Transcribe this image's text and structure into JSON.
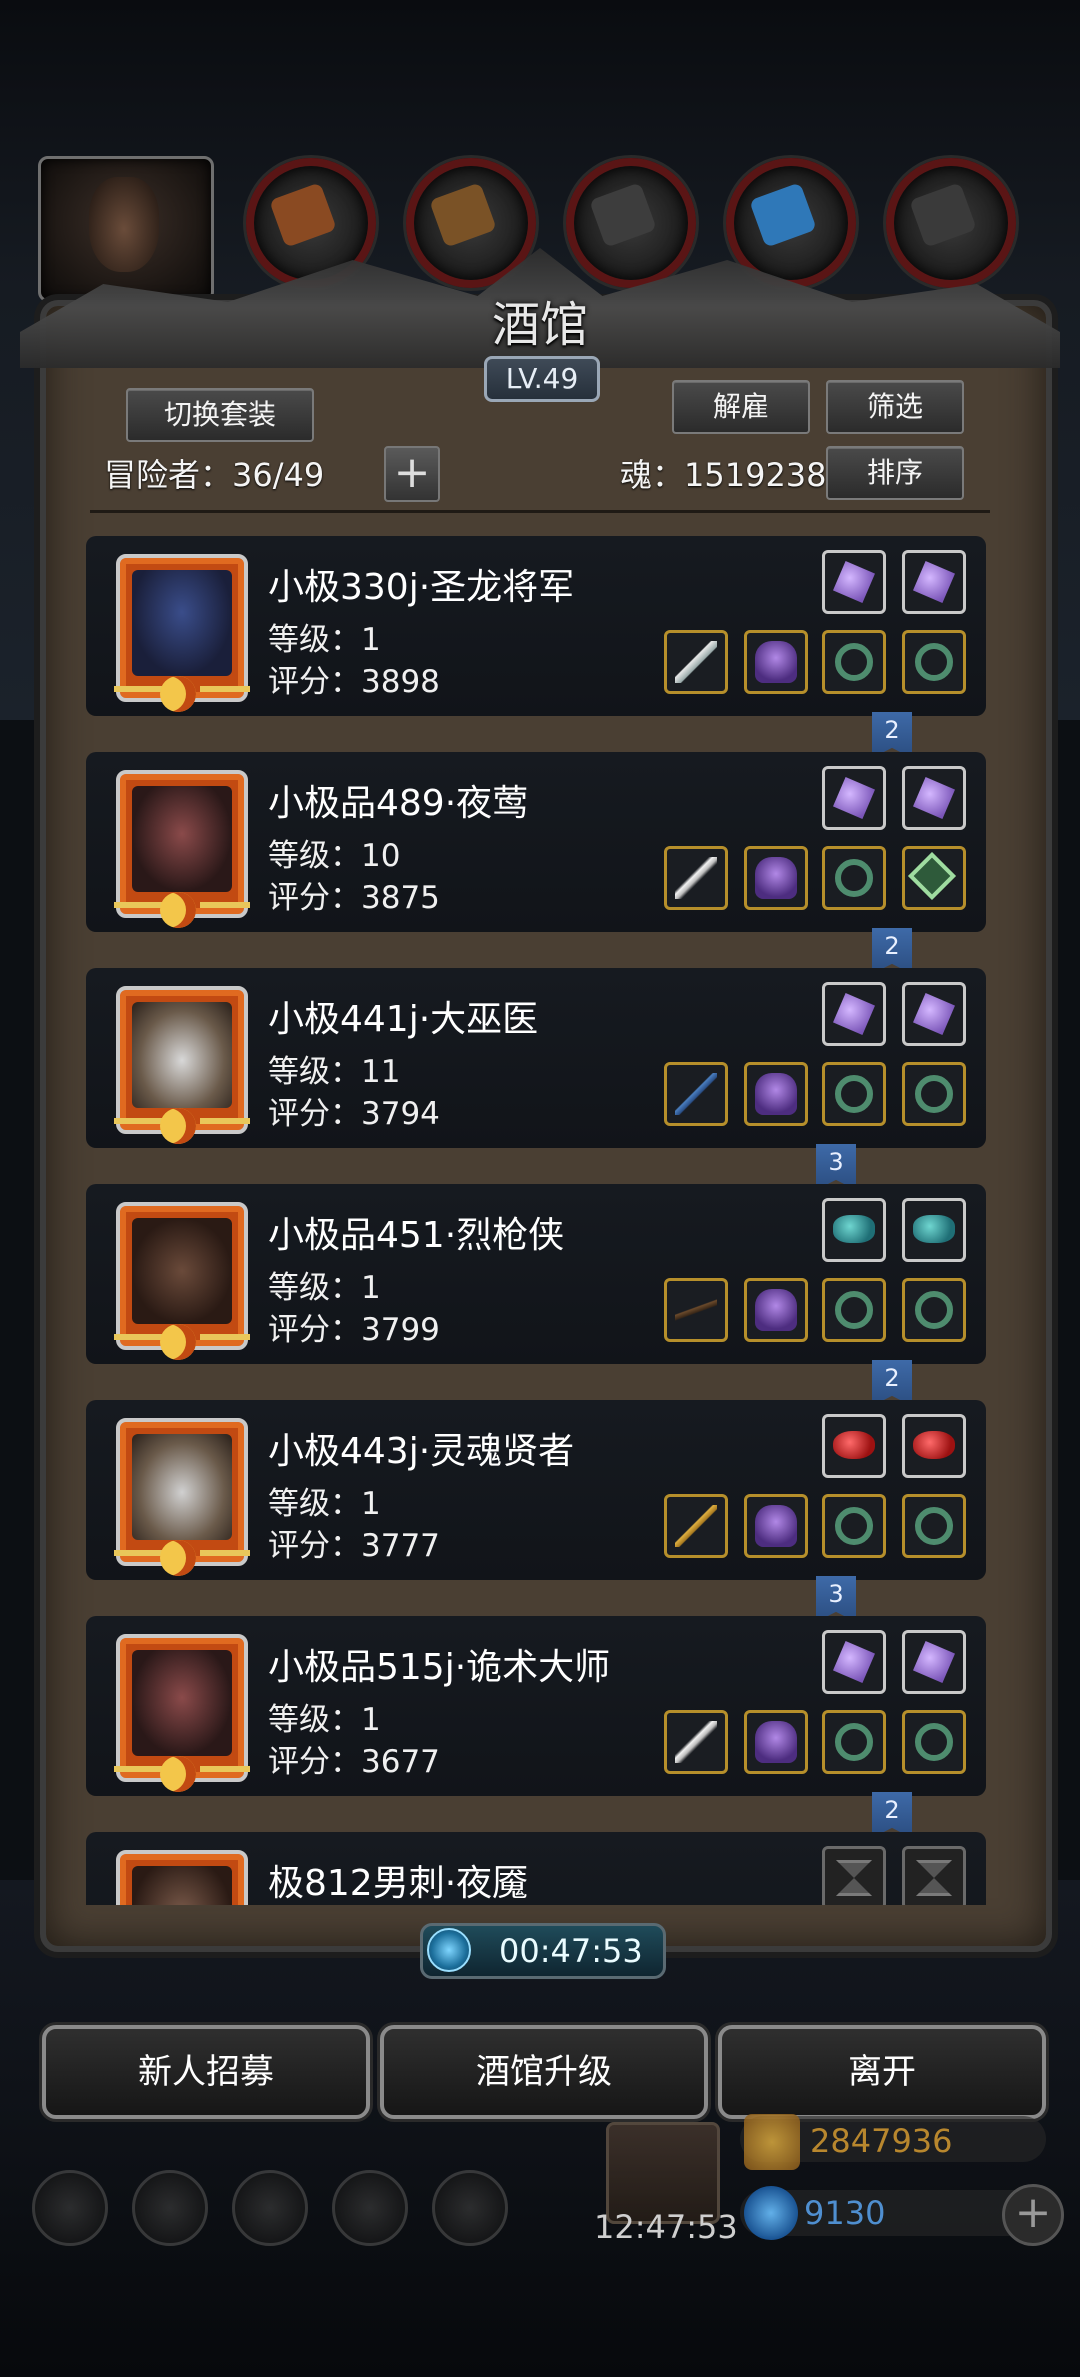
{
  "title": "酒馆",
  "level": "LV.49",
  "buttons": {
    "switch_outfit": "切换套装",
    "dismiss": "解雇",
    "filter": "筛选",
    "sort": "排序",
    "add": "+"
  },
  "stats": {
    "adventurers_label": "冒险者：36/49",
    "soul_label": "魂：1519238"
  },
  "adventurers": [
    {
      "name": "小极330j·圣龙将军",
      "level": "等级：1",
      "score": "评分：3898",
      "weapon": "sword",
      "gems": [
        "gem-purple",
        "gem-purple"
      ],
      "gem_badge": ""
    },
    {
      "name": "小极品489·夜莺",
      "level": "等级：10",
      "score": "评分：3875",
      "weapon": "blade",
      "gems": [
        "gem-purple",
        "gem-purple"
      ],
      "gem_badge": "2"
    },
    {
      "name": "小极441j·大巫医",
      "level": "等级：11",
      "score": "评分：3794",
      "weapon": "staff",
      "gems": [
        "gem-purple",
        "gem-purple"
      ],
      "gem_badge": "2"
    },
    {
      "name": "小极品451·烈枪侠",
      "level": "等级：1",
      "score": "评分：3799",
      "weapon": "gun",
      "gems": [
        "gem-teal",
        "gem-teal"
      ],
      "gem_badge": "3"
    },
    {
      "name": "小极443j·灵魂贤者",
      "level": "等级：1",
      "score": "评分：3777",
      "weapon": "wand",
      "gems": [
        "gem-red",
        "gem-red"
      ],
      "gem_badge": "2"
    },
    {
      "name": "小极品515j·诡术大师",
      "level": "等级：1",
      "score": "评分：3677",
      "weapon": "blade",
      "gems": [
        "gem-purple",
        "gem-purple"
      ],
      "gem_badge": "3"
    },
    {
      "name": "极812男刺·夜魇",
      "level": "",
      "score": "",
      "weapon": "",
      "gems": [
        "hourglass",
        "hourglass"
      ],
      "gem_badge": "2"
    }
  ],
  "timer": "00:47:53",
  "actions": {
    "recruit": "新人招募",
    "upgrade": "酒馆升级",
    "leave": "离开"
  },
  "hud": {
    "gold": "2847936",
    "gems": "9130",
    "clock": "12:47:53",
    "add": "+"
  },
  "colors": {
    "panel": "#4a3f33",
    "row": "#161a20",
    "gold_border": "#b68f2b",
    "ribbon": "#3e6aa8"
  }
}
